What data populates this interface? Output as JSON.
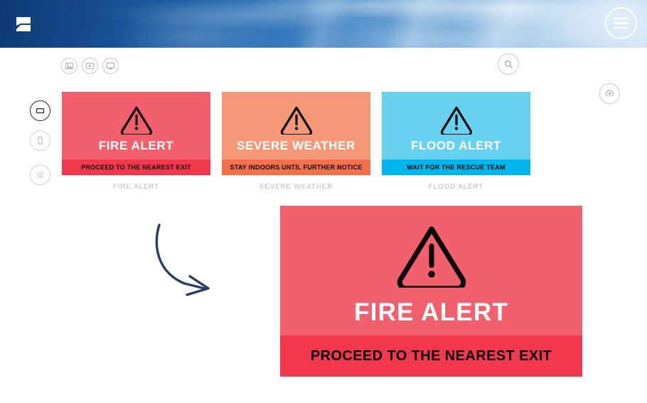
{
  "header": {
    "logo_icon": "app-logo-icon",
    "menu_icon": "hamburger-menu-icon",
    "gradient_start": "#0d3a75",
    "gradient_end": "#c6dff5"
  },
  "toolbar": {
    "media_icons": [
      {
        "name": "image-icon",
        "title": "Image"
      },
      {
        "name": "video-icon",
        "title": "Video"
      },
      {
        "name": "screen-icon",
        "title": "Screen"
      }
    ],
    "search_icon": "search-icon",
    "upload_icon": "cloud-upload-icon"
  },
  "sidebar": {
    "items": [
      {
        "name": "layout-landscape",
        "icon": "landscape-screen-icon",
        "active": true
      },
      {
        "name": "layout-portrait",
        "icon": "portrait-screen-icon",
        "active": false
      },
      {
        "name": "apps-grid",
        "icon": "grid-apps-icon",
        "active": false
      }
    ]
  },
  "cards": [
    {
      "title": "FIRE ALERT",
      "message": "PROCEED TO THE NEAREST EXIT",
      "caption": "FIRE ALERT",
      "body_color": "#f2606e",
      "banner_color": "#f2384c",
      "icon": "warning-triangle-icon"
    },
    {
      "title": "SEVERE WEATHER",
      "message": "STAY INDOORS UNTIL FURTHER NOTICE",
      "caption": "SEVERE WEATHER",
      "body_color": "#f59878",
      "banner_color": "#f2704c",
      "icon": "warning-triangle-icon"
    },
    {
      "title": "FLOOD ALERT",
      "message": "WAIT FOR THE RESCUE TEAM",
      "caption": "FLOOD ALERT",
      "body_color": "#66d2f0",
      "banner_color": "#00b5ec",
      "icon": "warning-triangle-icon"
    }
  ],
  "preview": {
    "title": "FIRE ALERT",
    "message": "PROCEED TO THE NEAREST EXIT",
    "body_color": "#f2606e",
    "banner_color": "#f2384c",
    "icon": "warning-triangle-icon"
  },
  "arrow": {
    "name": "curved-arrow",
    "color": "#2b3d63"
  }
}
